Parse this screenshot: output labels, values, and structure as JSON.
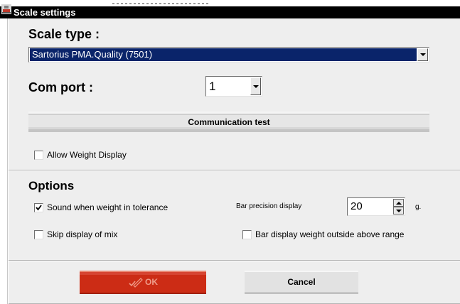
{
  "window": {
    "title": "Scale settings"
  },
  "scale_type": {
    "label": "Scale type :",
    "selected": "Sartorius PMA.Quality (7501)"
  },
  "com_port": {
    "label": "Com port :",
    "selected": "1"
  },
  "communication_test": {
    "label": "Communication test"
  },
  "allow_weight_display": {
    "label": "Allow Weight Display",
    "checked": false
  },
  "options": {
    "heading": "Options",
    "sound_tolerance": {
      "label": "Sound when weight in tolerance",
      "checked": true
    },
    "bar_precision": {
      "label": "Bar precision display",
      "value": "20",
      "unit": "g."
    },
    "skip_display_mix": {
      "label": "Skip display of mix",
      "checked": false
    },
    "bar_outside_range": {
      "label": "Bar display weight outside above range",
      "checked": false
    }
  },
  "footer": {
    "ok_label": "OK",
    "cancel_label": "Cancel"
  },
  "colors": {
    "title_bar": "#000000",
    "dialog_bg": "#eeeeee",
    "select_highlight": "#0a246a",
    "ok_button": "#cc2c15"
  },
  "icons": {
    "app": "scale-app-icon",
    "ok": "pencil-check-icon",
    "dropdown": "chevron-down-icon"
  }
}
